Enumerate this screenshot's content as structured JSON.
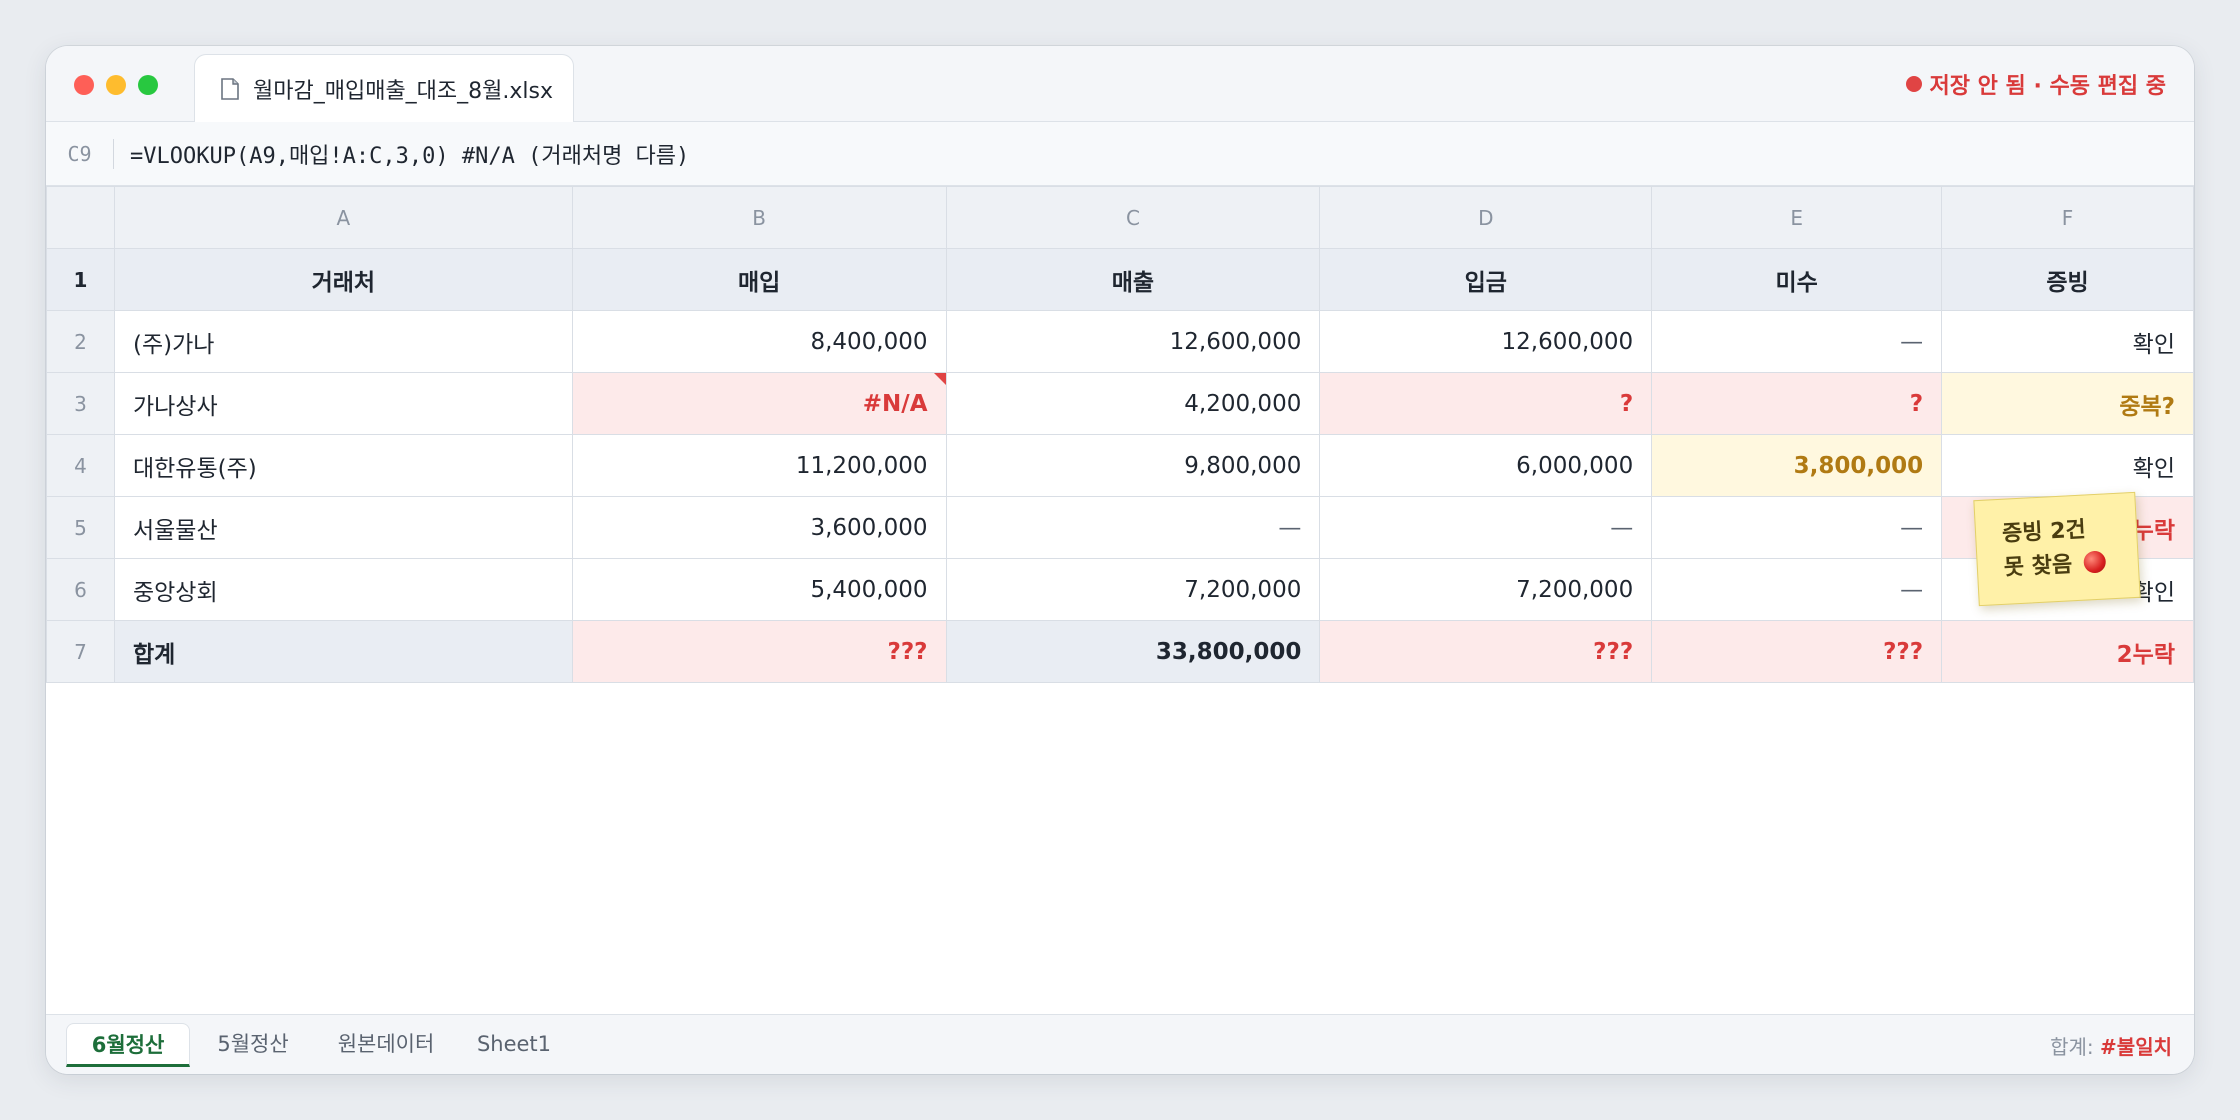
{
  "window": {
    "file_name": "월마감_매입매출_대조_8월.xlsx",
    "save_status": "저장 안 됨 · 수동 편집 중"
  },
  "formula_bar": {
    "cell_ref": "C9",
    "formula": "=VLOOKUP(A9,매입!A:C,3,0) #N/A (거래처명 다름)"
  },
  "columns": [
    "A",
    "B",
    "C",
    "D",
    "E",
    "F"
  ],
  "rows": [
    {
      "num": "1",
      "cells": [
        "거래처",
        "매입",
        "매출",
        "입금",
        "미수",
        "증빙"
      ]
    },
    {
      "num": "2",
      "cells": [
        "(주)가나",
        "8,400,000",
        "12,600,000",
        "12,600,000",
        "—",
        "확인"
      ]
    },
    {
      "num": "3",
      "cells": [
        "가나상사",
        "#N/A",
        "4,200,000",
        "?",
        "?",
        "중복?"
      ]
    },
    {
      "num": "4",
      "cells": [
        "대한유통(주)",
        "11,200,000",
        "9,800,000",
        "6,000,000",
        "3,800,000",
        "확인"
      ]
    },
    {
      "num": "5",
      "cells": [
        "서울물산",
        "3,600,000",
        "—",
        "—",
        "—",
        "누락"
      ]
    },
    {
      "num": "6",
      "cells": [
        "중앙상회",
        "5,400,000",
        "7,200,000",
        "7,200,000",
        "—",
        "확인"
      ]
    },
    {
      "num": "7",
      "cells": [
        "합계",
        "???",
        "33,800,000",
        "???",
        "???",
        "2누락"
      ]
    }
  ],
  "sticky_note": {
    "line1": "증빙 2건",
    "line2": "못 찾음"
  },
  "sheets": [
    "6월정산",
    "5월정산",
    "원본데이터",
    "Sheet1"
  ],
  "active_sheet": "6월정산",
  "status": {
    "label": "합계:",
    "value": "#불일치"
  },
  "colors": {
    "error": "#d93a3a",
    "warning": "#b07a13",
    "active_tab": "#1d6e3a"
  }
}
